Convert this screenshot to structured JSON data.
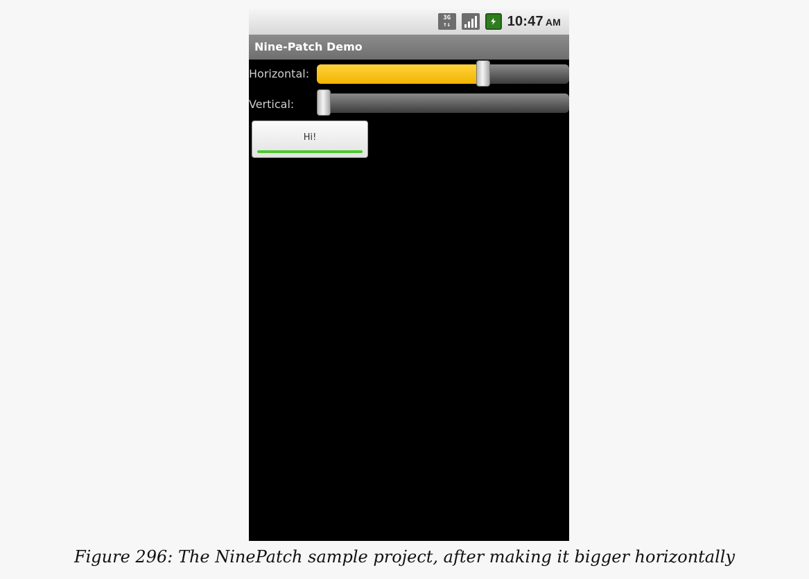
{
  "status_bar": {
    "icons": [
      "3g-data-icon",
      "signal-strength-icon",
      "battery-charging-icon"
    ],
    "network_label_top": "3G",
    "network_label_bottom": "↑↓",
    "time": "10:47",
    "ampm": "AM"
  },
  "app": {
    "title": "Nine-Patch Demo"
  },
  "horizontal": {
    "label": "Horizontal:",
    "value_fraction": 0.67
  },
  "vertical": {
    "label": "Vertical:",
    "value_fraction": 0.0
  },
  "button": {
    "label": "Hi!"
  },
  "caption": "Figure 296: The NinePatch sample project, after making it bigger horizontally",
  "colors": {
    "accent": "#f2b400",
    "indicator": "#4ec92e"
  }
}
